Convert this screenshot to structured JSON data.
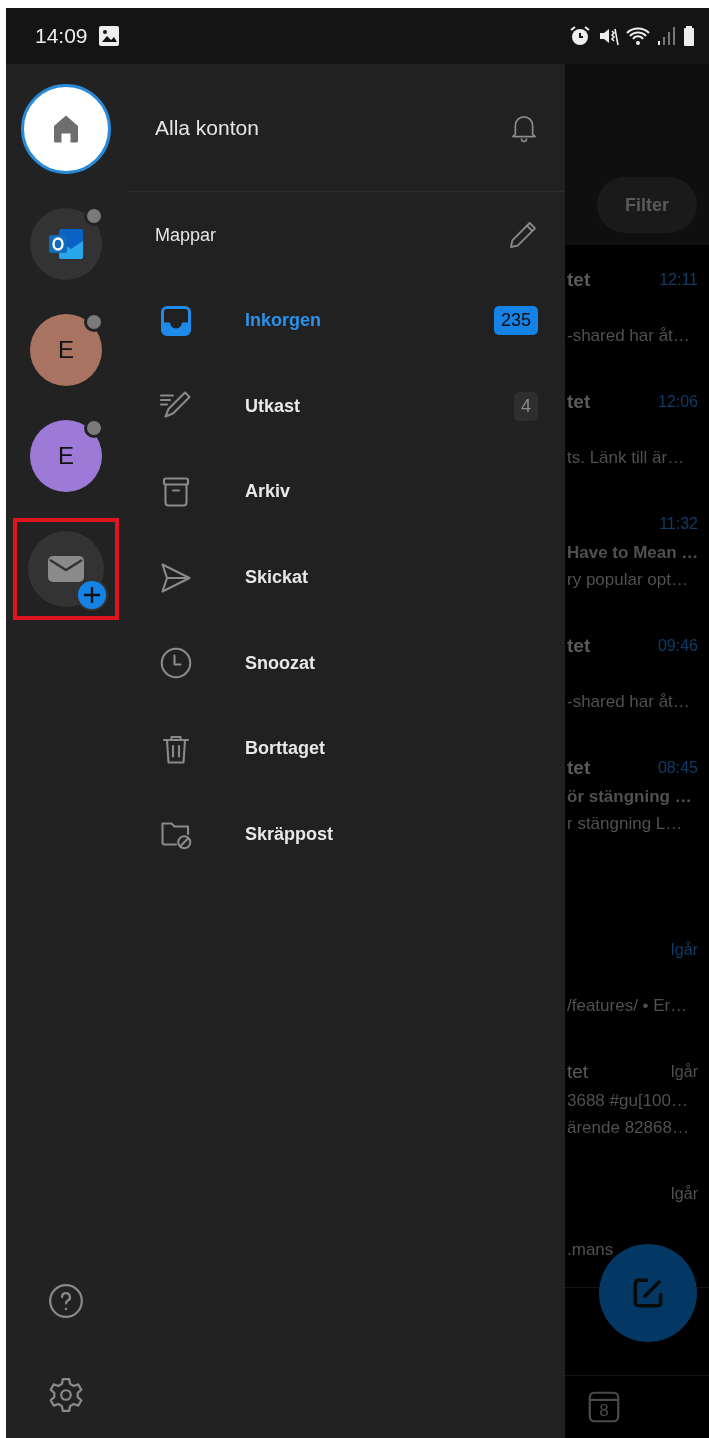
{
  "status_bar": {
    "time": "14:09"
  },
  "accounts_rail": {
    "items": [
      {
        "kind": "home",
        "selected": true,
        "unread_dot": false
      },
      {
        "kind": "outlook",
        "selected": false,
        "unread_dot": true
      },
      {
        "kind": "avatar",
        "initial": "E",
        "color": "#a87461",
        "selected": false,
        "unread_dot": true
      },
      {
        "kind": "avatar",
        "initial": "E",
        "color": "#9e7ad8",
        "selected": false,
        "unread_dot": true
      },
      {
        "kind": "add_account",
        "selected": false,
        "unread_dot": false,
        "highlighted": true
      }
    ]
  },
  "drawer": {
    "title": "Alla konton",
    "section": "Mappar",
    "folders": [
      {
        "kind": "inbox",
        "label": "Inkorgen",
        "count": "235",
        "selected": true
      },
      {
        "kind": "drafts",
        "label": "Utkast",
        "count": "4",
        "selected": false
      },
      {
        "kind": "archive",
        "label": "Arkiv",
        "selected": false
      },
      {
        "kind": "sent",
        "label": "Skickat",
        "selected": false
      },
      {
        "kind": "snoozed",
        "label": "Snoozat",
        "selected": false
      },
      {
        "kind": "deleted",
        "label": "Borttaget",
        "selected": false
      },
      {
        "kind": "junk",
        "label": "Skräppost",
        "selected": false
      }
    ]
  },
  "mail_list": {
    "filter": "Filter",
    "rows": [
      {
        "title": "tet",
        "time": "12:11",
        "preview": "-shared har åt…",
        "unread": true
      },
      {
        "title": "tet",
        "time": "12:06",
        "preview": "ts. Länk till är…",
        "unread": true
      },
      {
        "time": "11:32",
        "subject": "Have to Mean …",
        "preview": "ry popular opt…",
        "unread": true
      },
      {
        "title": "tet",
        "time": "09:46",
        "preview": "-shared har åt…",
        "unread": true
      },
      {
        "title": "tet",
        "time": "08:45",
        "subject": "ör stängning …",
        "preview": "r stängning L…",
        "unread": true
      },
      {
        "time": "Igår",
        "preview": "/features/ • Er…",
        "unread": true
      },
      {
        "title": "tet",
        "time": "Igår",
        "subject": "3688  #gu[100…",
        "preview": "ärende 82868…",
        "unread": false
      },
      {
        "time": "Igår",
        "preview": ".mans",
        "unread": false
      }
    ],
    "calendar_day": "8"
  }
}
